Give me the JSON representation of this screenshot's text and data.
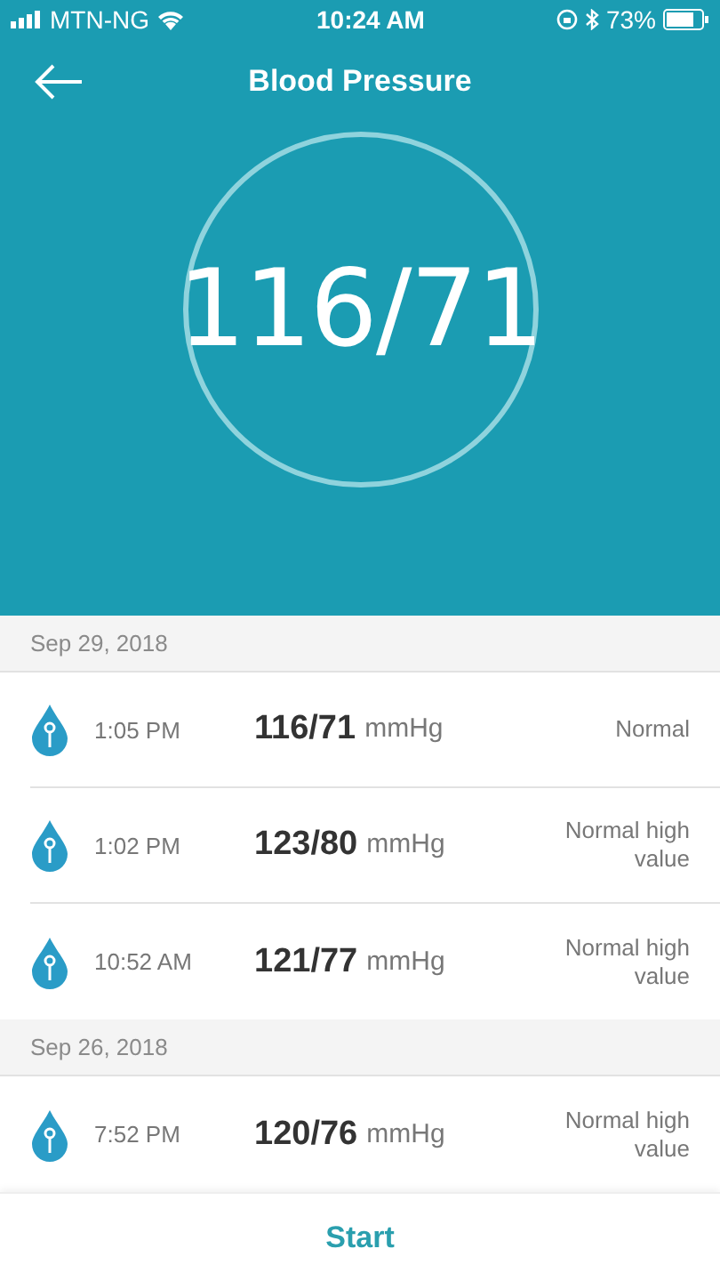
{
  "status_bar": {
    "carrier": "MTN-NG",
    "time": "10:24 AM",
    "battery": "73%"
  },
  "header": {
    "title": "Blood Pressure",
    "reading": "116/71"
  },
  "groups": [
    {
      "date": "Sep 29, 2018",
      "entries": [
        {
          "time": "1:05 PM",
          "value": "116/71",
          "unit": "mmHg",
          "status": "Normal"
        },
        {
          "time": "1:02 PM",
          "value": "123/80",
          "unit": "mmHg",
          "status": "Normal high value"
        },
        {
          "time": "10:52 AM",
          "value": "121/77",
          "unit": "mmHg",
          "status": "Normal high value"
        }
      ]
    },
    {
      "date": "Sep 26, 2018",
      "entries": [
        {
          "time": "7:52 PM",
          "value": "120/76",
          "unit": "mmHg",
          "status": "Normal high value"
        }
      ]
    }
  ],
  "action": "Start"
}
